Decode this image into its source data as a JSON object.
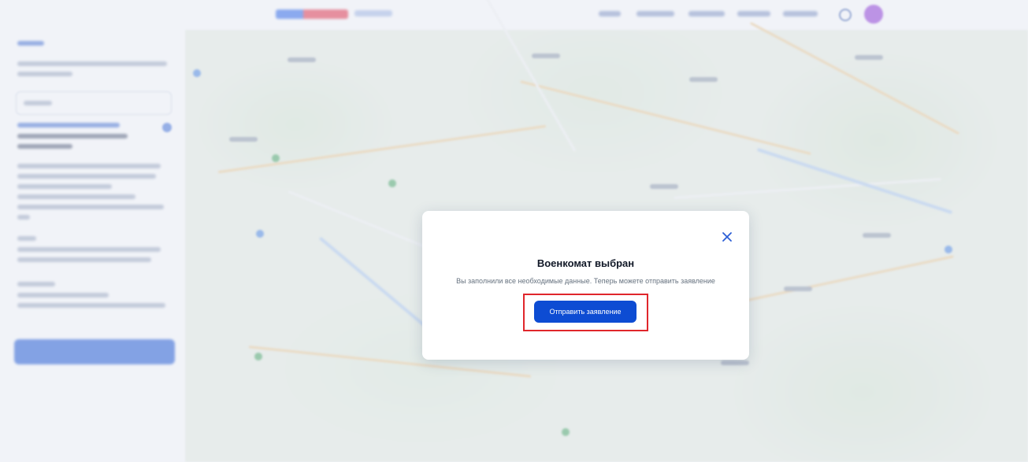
{
  "modal": {
    "title": "Военкомат выбран",
    "description": "Вы заполнили все необходимые данные. Теперь можете отправить заявление",
    "submit_label": "Отправить заявление",
    "close_icon": "close-icon"
  },
  "colors": {
    "primary": "#0d4cd3",
    "highlight": "#e0262b",
    "title": "#111827",
    "description": "#66727f"
  }
}
